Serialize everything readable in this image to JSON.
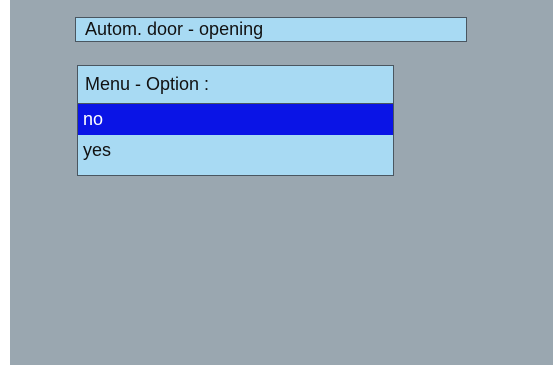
{
  "title": "Autom. door - opening",
  "menu": {
    "header": "Menu - Option :",
    "options": [
      {
        "label": "no",
        "selected": true
      },
      {
        "label": "yes",
        "selected": false
      }
    ]
  },
  "colors": {
    "background": "#9aa7b0",
    "panel": "#a8daf3",
    "selection": "#0a14e6",
    "border": "#4a5660"
  }
}
